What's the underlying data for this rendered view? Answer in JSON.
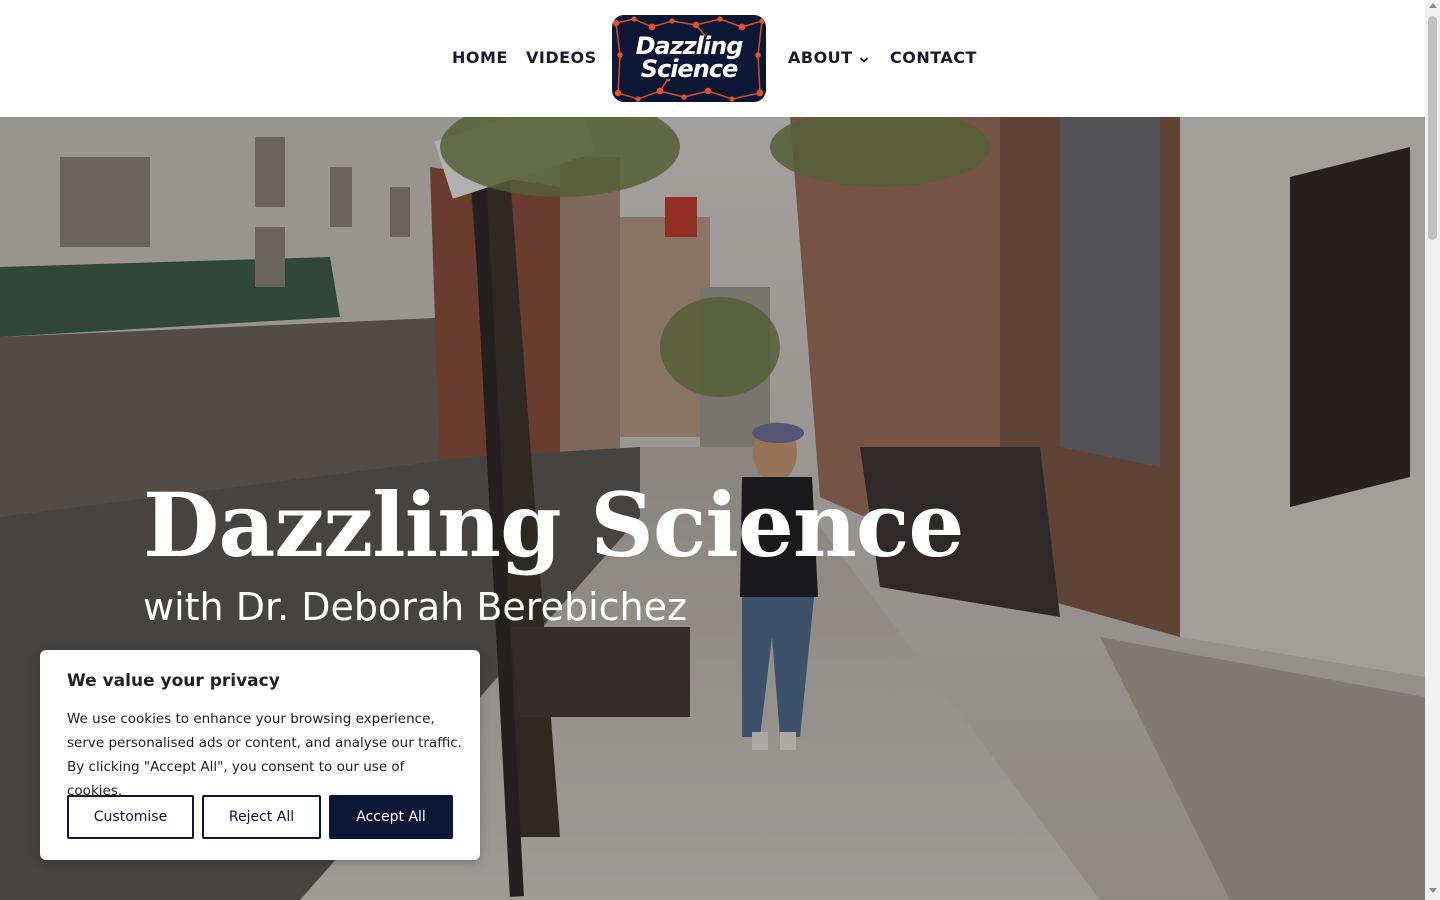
{
  "header": {
    "nav": {
      "home": "HOME",
      "videos": "VIDEOS",
      "about": "ABOUT",
      "contact": "CONTACT"
    },
    "logo": {
      "line1": "Dazzling",
      "line2": "Science"
    }
  },
  "hero": {
    "title": "Dazzling Science",
    "subtitle": "with Dr. Deborah Berebichez"
  },
  "cookie_banner": {
    "title": "We value your privacy",
    "text": "We use cookies to enhance your browsing experience, serve personalised ads or content, and analyse our traffic. By clicking \"Accept All\", you consent to our use of cookies.",
    "buttons": {
      "customise": "Customise",
      "reject": "Reject All",
      "accept": "Accept All"
    }
  },
  "colors": {
    "brand_navy": "#0c1736",
    "logo_accent": "#e8502a",
    "nav_text": "#1a1a2e"
  },
  "icons": {
    "about_dropdown": "chevron-down-icon"
  }
}
